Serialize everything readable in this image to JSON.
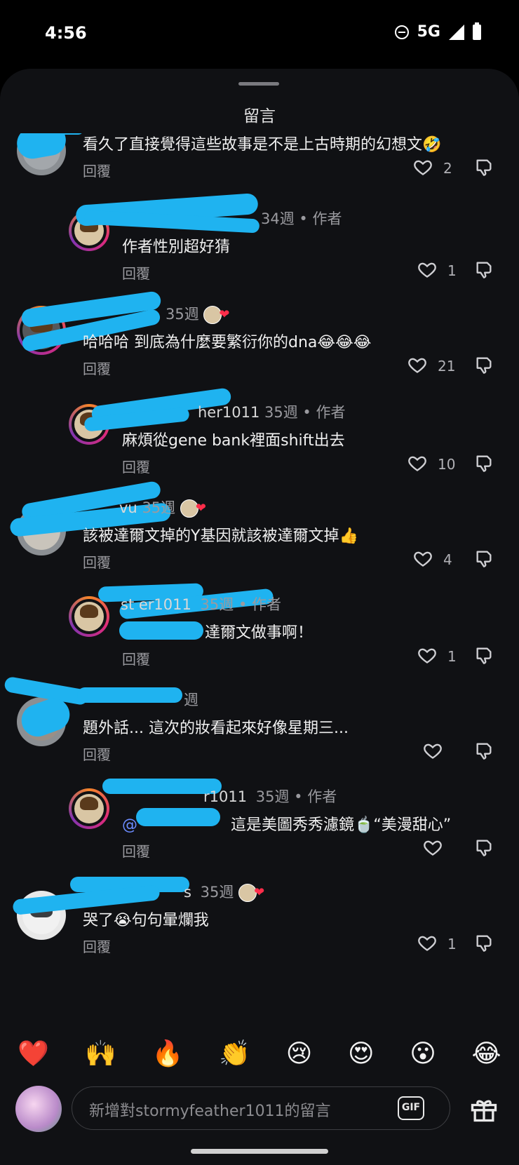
{
  "status_bar": {
    "time": "4:56",
    "network": "5G"
  },
  "sheet": {
    "title": "留言"
  },
  "comments": [
    {
      "text": "看久了直接覺得這些故事是不是上古時期的幻想文🤣",
      "reply_label": "回覆",
      "likes": "2"
    },
    {
      "username": "",
      "time": "34週",
      "role": "作者",
      "text": "作者性別超好猜",
      "reply_label": "回覆",
      "likes": "1"
    },
    {
      "username": "",
      "time": "35週",
      "text": "哈哈哈 到底為什麼要繁衍你的dna😂😂😂",
      "reply_label": "回覆",
      "likes": "21"
    },
    {
      "username": "her1011",
      "time": "35週",
      "role": "作者",
      "text": "麻煩從gene bank裡面shift出去",
      "reply_label": "回覆",
      "likes": "10"
    },
    {
      "username": "vu",
      "time": "35週",
      "text": "該被達爾文掉的Y基因就該被達爾文掉👍",
      "reply_label": "回覆",
      "likes": "4"
    },
    {
      "username": "st er1011",
      "time": "35週",
      "role": "作者",
      "text": "達爾文做事啊！",
      "reply_label": "回覆",
      "likes": "1"
    },
    {
      "username": "",
      "time": "週",
      "text": "題外話... 這次的妝看起來好像星期三...",
      "reply_label": "回覆",
      "likes": ""
    },
    {
      "username": "r1011",
      "time": "35週",
      "role": "作者",
      "mention": "@",
      "text": "這是美圖秀秀濾鏡🍵“美漫甜心”",
      "reply_label": "回覆",
      "likes": ""
    },
    {
      "username": "s",
      "time": "35週",
      "text": "哭了😭句句暈爛我",
      "reply_label": "回覆",
      "likes": "1"
    }
  ],
  "reactions": [
    "❤️",
    "🙌",
    "🔥",
    "👏",
    "😢",
    "😍",
    "😮",
    "😂"
  ],
  "composer": {
    "placeholder": "新增對stormyfeather1011的留言",
    "gif_label": "GIF"
  }
}
